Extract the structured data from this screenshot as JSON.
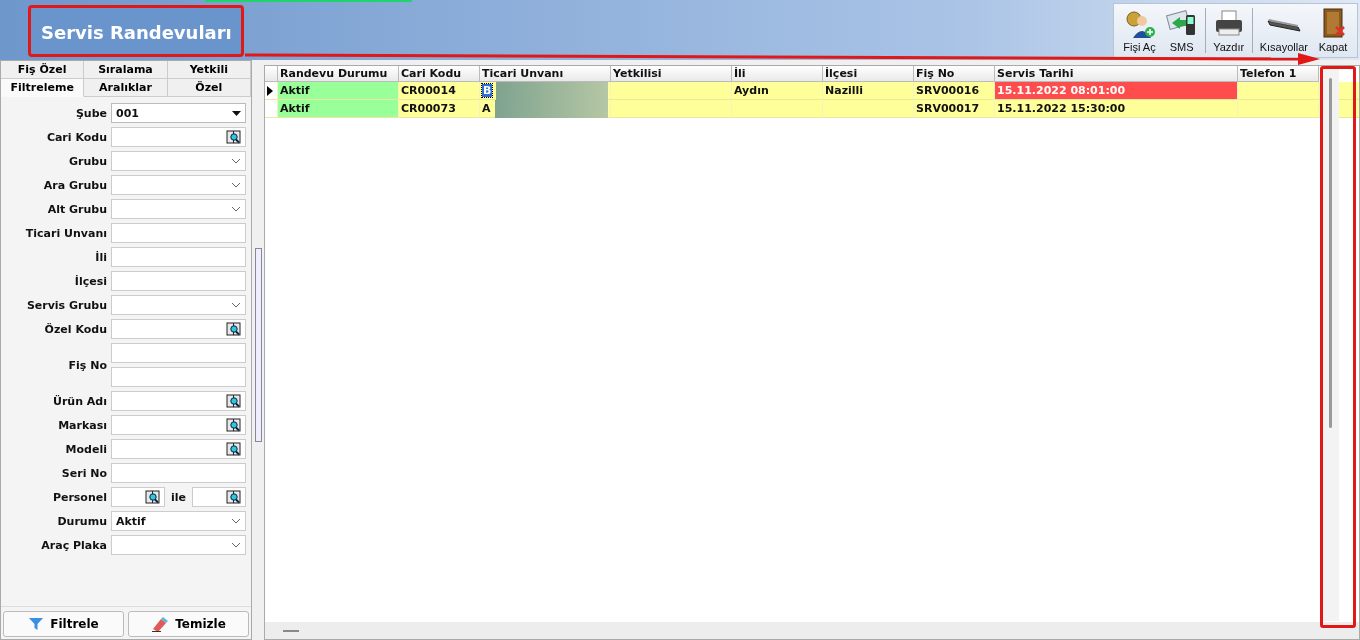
{
  "window": {
    "title": "Servis Randevuları"
  },
  "toolbar": [
    {
      "label": "Fişi Aç",
      "kind": "open"
    },
    {
      "label": "SMS",
      "kind": "sms"
    },
    {
      "label": "Yazdır",
      "kind": "print"
    },
    {
      "label": "Kısayollar",
      "kind": "keyboard"
    },
    {
      "label": "Kapat",
      "kind": "close"
    }
  ],
  "tabs": [
    [
      {
        "label": "Fiş Özel",
        "selected": false
      },
      {
        "label": "Sıralama",
        "selected": false
      },
      {
        "label": "Yetkili",
        "selected": false
      }
    ],
    [
      {
        "label": "Filtreleme",
        "selected": true
      },
      {
        "label": "Aralıklar",
        "selected": false
      },
      {
        "label": "Özel",
        "selected": false
      }
    ]
  ],
  "filters": [
    {
      "label": "Şube",
      "kind": "combo",
      "value": "001"
    },
    {
      "label": "Cari Kodu",
      "kind": "lookup"
    },
    {
      "label": "Grubu",
      "kind": "dropdown"
    },
    {
      "label": "Ara Grubu",
      "kind": "dropdown"
    },
    {
      "label": "Alt Grubu",
      "kind": "dropdown"
    },
    {
      "label": "Ticari Unvanı",
      "kind": "text"
    },
    {
      "label": "İli",
      "kind": "text"
    },
    {
      "label": "İlçesi",
      "kind": "text"
    },
    {
      "label": "Servis Grubu",
      "kind": "dropdown"
    },
    {
      "label": "Özel Kodu",
      "kind": "lookup"
    },
    {
      "label": "Fiş No",
      "kind": "range_text"
    },
    {
      "label": "Ürün Adı",
      "kind": "lookup"
    },
    {
      "label": "Markası",
      "kind": "lookup"
    },
    {
      "label": "Modeli",
      "kind": "lookup"
    },
    {
      "label": "Seri No",
      "kind": "text"
    },
    {
      "label": "Personel",
      "kind": "range_lookup",
      "between": "ile"
    },
    {
      "label": "Durumu",
      "kind": "dropdown",
      "value": "Aktif"
    },
    {
      "label": "Araç Plaka",
      "kind": "dropdown"
    }
  ],
  "buttons": [
    {
      "label": "Filtrele",
      "kind": "filter"
    },
    {
      "label": "Temizle",
      "kind": "clear"
    }
  ],
  "table": {
    "columns": [
      "Randevu Durumu",
      "Cari Kodu",
      "Ticari Unvanı",
      "Yetkilisi",
      "İli",
      "İlçesi",
      "Fiş No",
      "Servis Tarihi",
      "Telefon 1"
    ],
    "rows": [
      {
        "selected": true,
        "overdue": true,
        "cells": [
          "Aktif",
          "CR00014",
          "B",
          "",
          "Aydın",
          "Nazilli",
          "SRV00016",
          "15.11.2022 08:01:00",
          ""
        ]
      },
      {
        "selected": false,
        "overdue": false,
        "cells": [
          "Aktif",
          "CR00073",
          "A",
          "",
          "",
          "",
          "SRV00017",
          "15.11.2022 15:30:00",
          ""
        ]
      }
    ]
  }
}
